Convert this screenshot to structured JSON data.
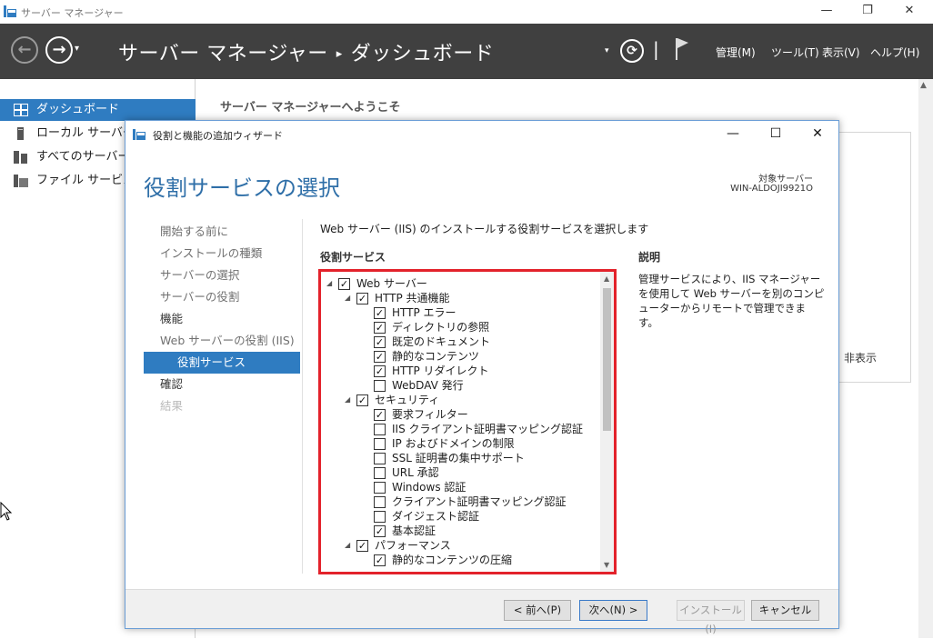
{
  "app": {
    "window_title": "サーバー マネージャー",
    "controls": {
      "minimize": "—",
      "maximize": "❐",
      "close": "✕"
    }
  },
  "header": {
    "breadcrumb_root": "サーバー マネージャー",
    "breadcrumb_sep": "▸",
    "breadcrumb_page": "ダッシュボード",
    "back_glyph": "←",
    "forward_glyph": "→",
    "dropdown_glyph": "▾",
    "refresh_glyph": "⟳",
    "pipe": "|",
    "menu": [
      {
        "label": "管理(M)"
      },
      {
        "label": "ツール(T)"
      },
      {
        "label": "表示(V)"
      },
      {
        "label": "ヘルプ(H)"
      }
    ]
  },
  "sidebar": {
    "items": [
      {
        "label": "ダッシュボード",
        "icon": "dashboard-icon",
        "active": true
      },
      {
        "label": "ローカル サーバー",
        "icon": "local-server-icon",
        "active": false
      },
      {
        "label": "すべてのサーバー",
        "icon": "all-servers-icon",
        "active": false
      },
      {
        "label": "ファイル サービスと記",
        "icon": "file-services-icon",
        "active": false
      }
    ]
  },
  "main": {
    "welcome": "サーバー マネージャーへようこそ",
    "hide_label": "非表示"
  },
  "wizard": {
    "title": "役割と機能の追加ウィザード",
    "heading": "役割サービスの選択",
    "target_label": "対象サーバー",
    "target_server": "WIN-ALDOJI9921O",
    "steps": [
      {
        "label": "開始する前に",
        "state": "done"
      },
      {
        "label": "インストールの種類",
        "state": "done"
      },
      {
        "label": "サーバーの選択",
        "state": "done"
      },
      {
        "label": "サーバーの役割",
        "state": "done"
      },
      {
        "label": "機能",
        "state": "upcoming"
      },
      {
        "label": "Web サーバーの役割 (IIS)",
        "state": "done"
      },
      {
        "label": "役割サービス",
        "state": "current"
      },
      {
        "label": "確認",
        "state": "upcoming"
      },
      {
        "label": "結果",
        "state": "disabled"
      }
    ],
    "instruction": "Web サーバー (IIS) のインストールする役割サービスを選択します",
    "services_label": "役割サービス",
    "description_label": "説明",
    "description_text": "管理サービスにより、IIS マネージャーを使用して Web サーバーを別のコンピューターからリモートで管理できます。",
    "tree": [
      {
        "label": "Web サーバー",
        "level": 0,
        "expandable": true,
        "checked": true
      },
      {
        "label": "HTTP 共通機能",
        "level": 1,
        "expandable": true,
        "checked": true
      },
      {
        "label": "HTTP エラー",
        "level": 2,
        "expandable": false,
        "checked": true
      },
      {
        "label": "ディレクトリの参照",
        "level": 2,
        "expandable": false,
        "checked": true
      },
      {
        "label": "既定のドキュメント",
        "level": 2,
        "expandable": false,
        "checked": true
      },
      {
        "label": "静的なコンテンツ",
        "level": 2,
        "expandable": false,
        "checked": true
      },
      {
        "label": "HTTP リダイレクト",
        "level": 2,
        "expandable": false,
        "checked": true
      },
      {
        "label": "WebDAV 発行",
        "level": 2,
        "expandable": false,
        "checked": false
      },
      {
        "label": "セキュリティ",
        "level": 1,
        "expandable": true,
        "checked": true
      },
      {
        "label": "要求フィルター",
        "level": 2,
        "expandable": false,
        "checked": true
      },
      {
        "label": "IIS クライアント証明書マッピング認証",
        "level": 2,
        "expandable": false,
        "checked": false
      },
      {
        "label": "IP およびドメインの制限",
        "level": 2,
        "expandable": false,
        "checked": false
      },
      {
        "label": "SSL 証明書の集中サポート",
        "level": 2,
        "expandable": false,
        "checked": false
      },
      {
        "label": "URL 承認",
        "level": 2,
        "expandable": false,
        "checked": false
      },
      {
        "label": "Windows 認証",
        "level": 2,
        "expandable": false,
        "checked": false
      },
      {
        "label": "クライアント証明書マッピング認証",
        "level": 2,
        "expandable": false,
        "checked": false
      },
      {
        "label": "ダイジェスト認証",
        "level": 2,
        "expandable": false,
        "checked": false
      },
      {
        "label": "基本認証",
        "level": 2,
        "expandable": false,
        "checked": true
      },
      {
        "label": "パフォーマンス",
        "level": 1,
        "expandable": true,
        "checked": true
      },
      {
        "label": "静的なコンテンツの圧縮",
        "level": 2,
        "expandable": false,
        "checked": true
      }
    ],
    "expand_glyph": "◢",
    "check_glyph": "✓",
    "buttons": {
      "prev": "< 前へ(P)",
      "next": "次へ(N) >",
      "install": "インストール(I)",
      "cancel": "キャンセル"
    },
    "controls": {
      "minimize": "—",
      "maximize": "☐",
      "close": "✕"
    }
  },
  "colors": {
    "accent": "#2f7cc1",
    "header_bg": "#404040",
    "heading": "#2f6fa8",
    "highlight_border": "#e3222b"
  }
}
